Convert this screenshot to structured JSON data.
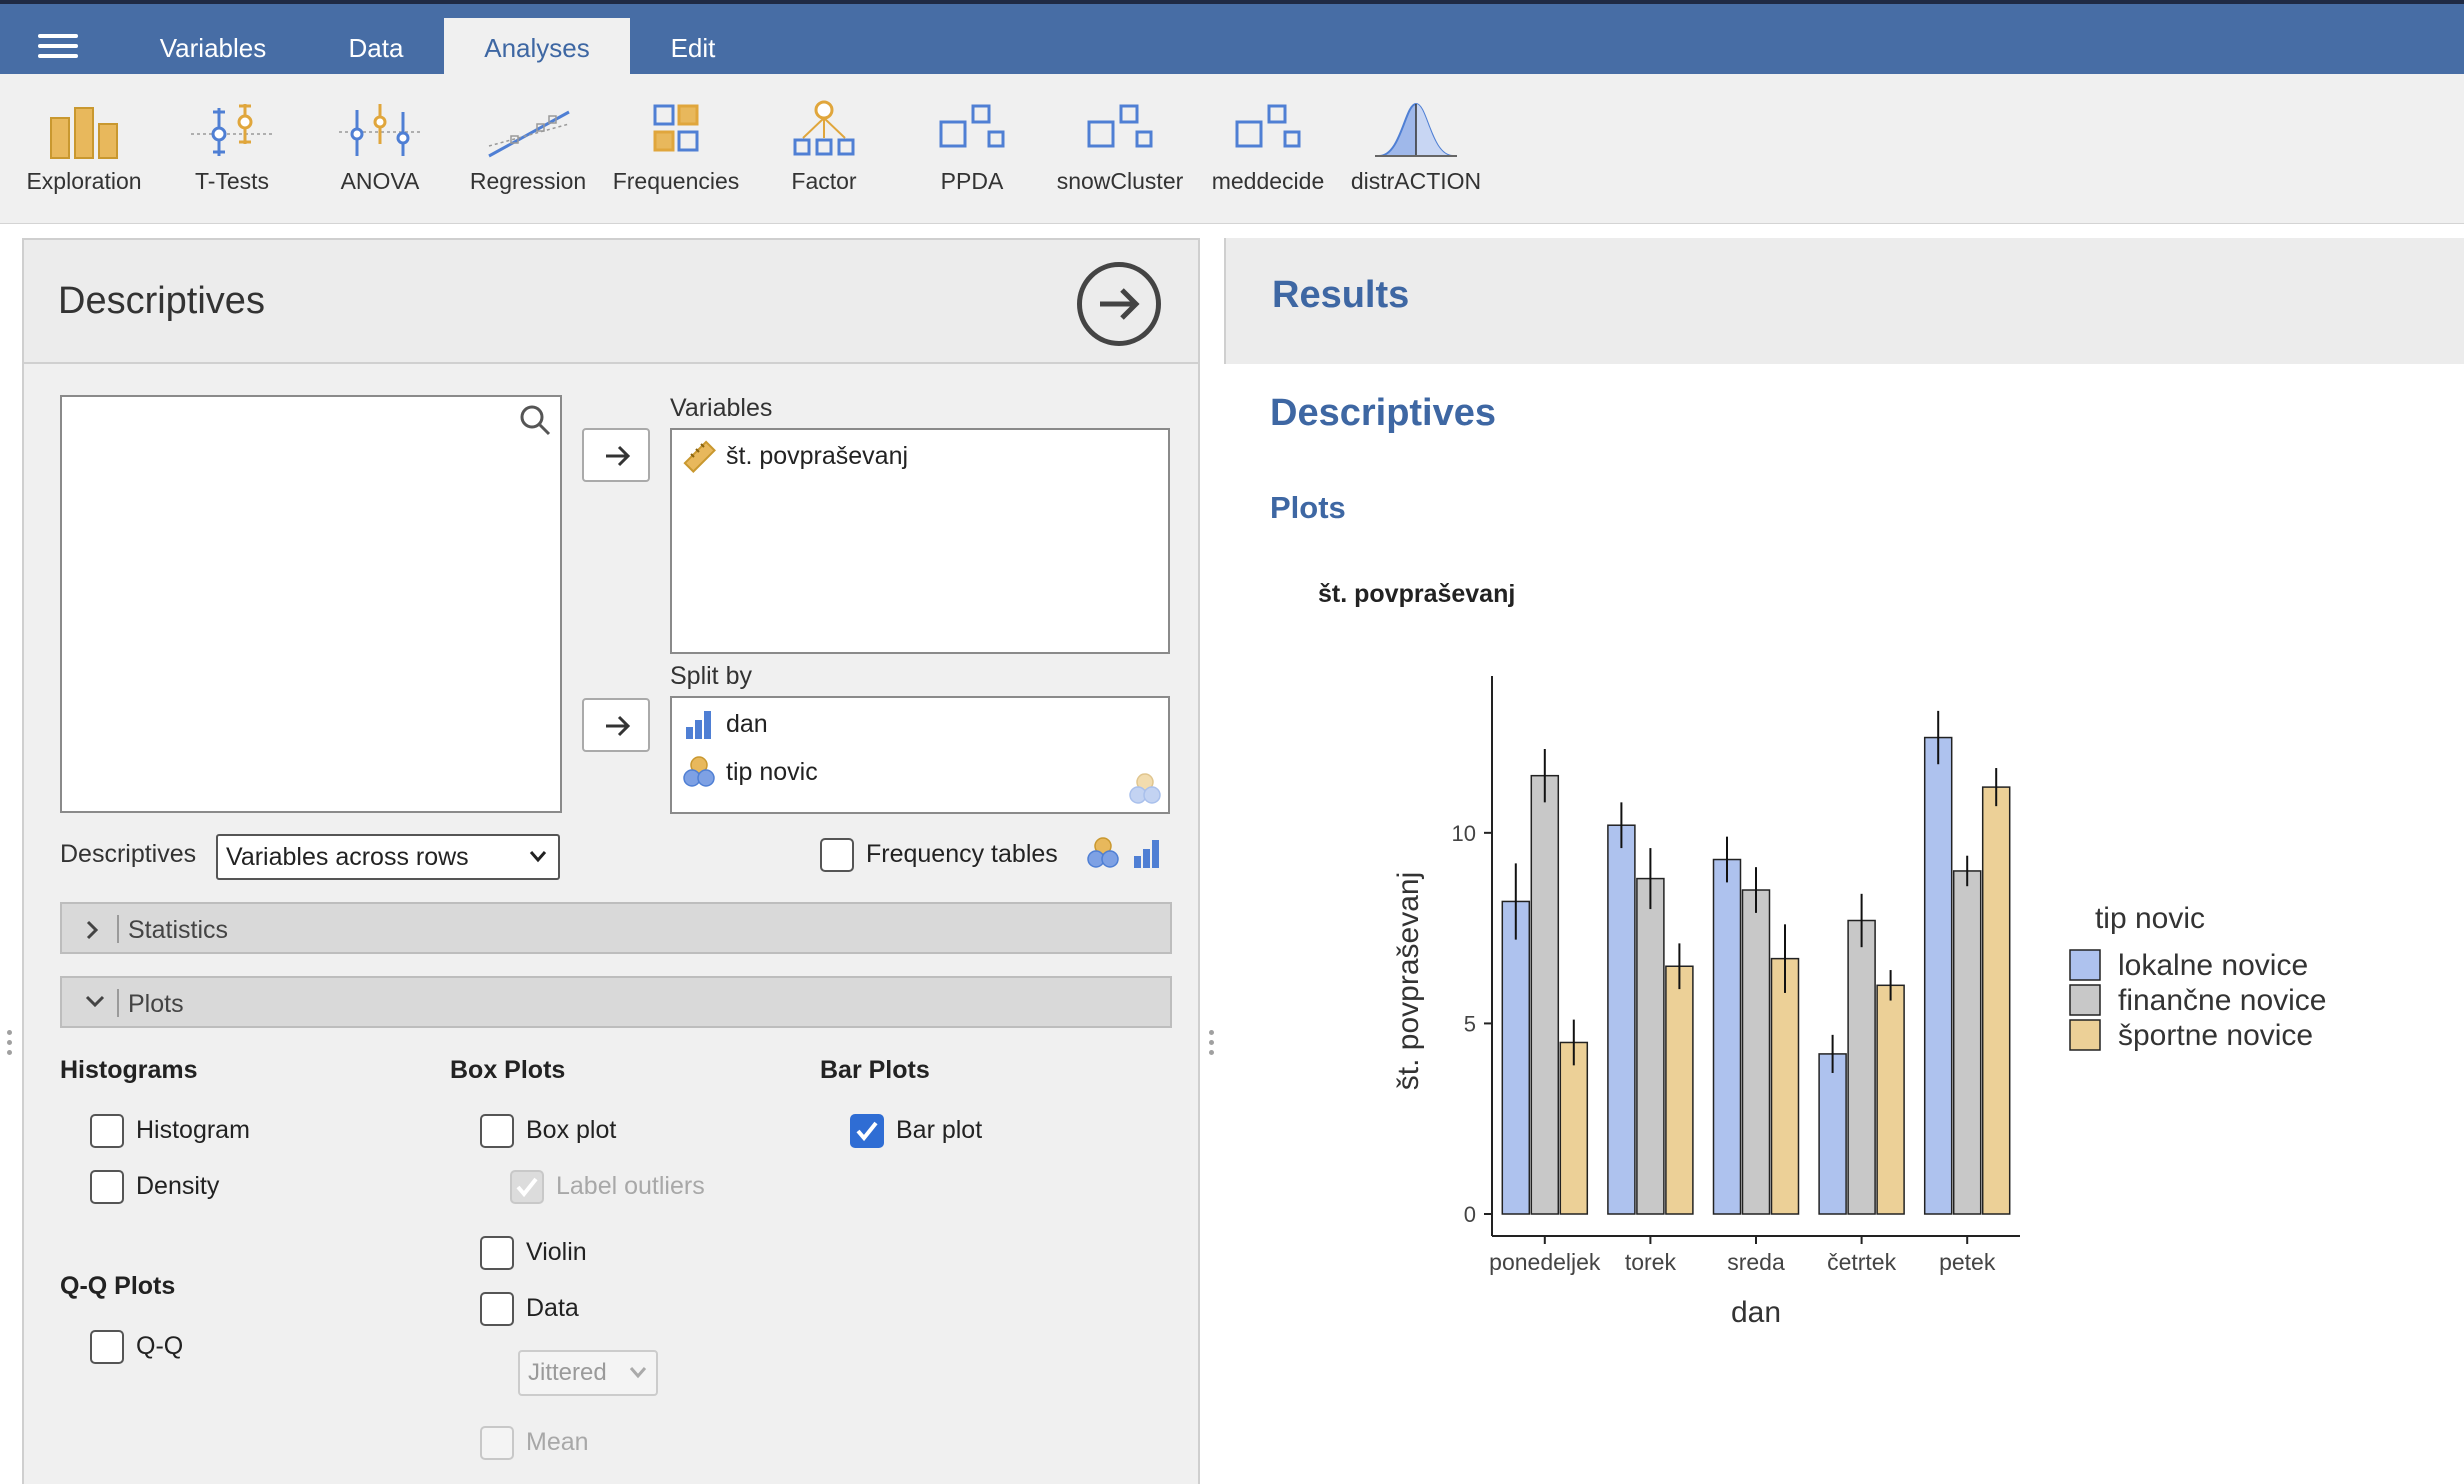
{
  "topbar": {
    "tabs": [
      {
        "label": "Variables",
        "active": false
      },
      {
        "label": "Data",
        "active": false
      },
      {
        "label": "Analyses",
        "active": true
      },
      {
        "label": "Edit",
        "active": false
      }
    ]
  },
  "ribbon": {
    "tools": [
      {
        "label": "Exploration",
        "icon": "exploration-icon"
      },
      {
        "label": "T-Tests",
        "icon": "t-tests-icon"
      },
      {
        "label": "ANOVA",
        "icon": "anova-icon"
      },
      {
        "label": "Regression",
        "icon": "regression-icon"
      },
      {
        "label": "Frequencies",
        "icon": "frequencies-icon"
      },
      {
        "label": "Factor",
        "icon": "factor-icon"
      },
      {
        "label": "PPDA",
        "icon": "ppda-icon"
      },
      {
        "label": "snowCluster",
        "icon": "snowcluster-icon"
      },
      {
        "label": "meddecide",
        "icon": "meddecide-icon"
      },
      {
        "label": "distrACTION",
        "icon": "distraction-icon"
      }
    ]
  },
  "panel": {
    "title": "Descriptives",
    "variables_label": "Variables",
    "variables": [
      "št. povpraševanj"
    ],
    "splitby_label": "Split by",
    "splitby": [
      "dan",
      "tip novic"
    ],
    "descriptives_label": "Descriptives",
    "descriptives_select": "Variables across rows",
    "frequency_tables_label": "Frequency tables",
    "frequency_tables_checked": false,
    "sections": {
      "statistics": "Statistics",
      "plots": "Plots"
    },
    "histograms": {
      "heading": "Histograms",
      "histogram": "Histogram",
      "density": "Density"
    },
    "qq": {
      "heading": "Q-Q Plots",
      "qq": "Q-Q"
    },
    "boxplots": {
      "heading": "Box Plots",
      "box_plot": "Box plot",
      "label_outliers": "Label outliers",
      "violin": "Violin",
      "data": "Data",
      "jitter_select": "Jittered",
      "mean": "Mean"
    },
    "barplots": {
      "heading": "Bar Plots",
      "bar_plot": "Bar plot",
      "bar_plot_checked": true
    }
  },
  "results": {
    "header": "Results",
    "section": "Descriptives",
    "subsection": "Plots",
    "plot_title": "št. povpraševanj"
  },
  "chart_data": {
    "type": "bar",
    "title": "",
    "xlabel": "dan",
    "ylabel": "št. povpraševanj",
    "ylim": [
      0,
      13.8
    ],
    "yticks": [
      0,
      5,
      10
    ],
    "categories": [
      "ponedeljek",
      "torek",
      "sreda",
      "četrtek",
      "petek"
    ],
    "legend_title": "tip novic",
    "legend_position": "right",
    "series": [
      {
        "name": "lokalne novice",
        "color": "#aec2ee",
        "values": [
          8.2,
          10.2,
          9.3,
          4.2,
          12.5
        ],
        "err": [
          1.0,
          0.6,
          0.6,
          0.5,
          0.7
        ]
      },
      {
        "name": "finančne novice",
        "color": "#c8c8c8",
        "values": [
          11.5,
          8.8,
          8.5,
          7.7,
          9.0
        ],
        "err": [
          0.7,
          0.8,
          0.6,
          0.7,
          0.4
        ]
      },
      {
        "name": "športne novice",
        "color": "#ecd097",
        "values": [
          4.5,
          6.5,
          6.7,
          6.0,
          11.2
        ],
        "err": [
          0.6,
          0.6,
          0.9,
          0.4,
          0.5
        ]
      }
    ]
  }
}
